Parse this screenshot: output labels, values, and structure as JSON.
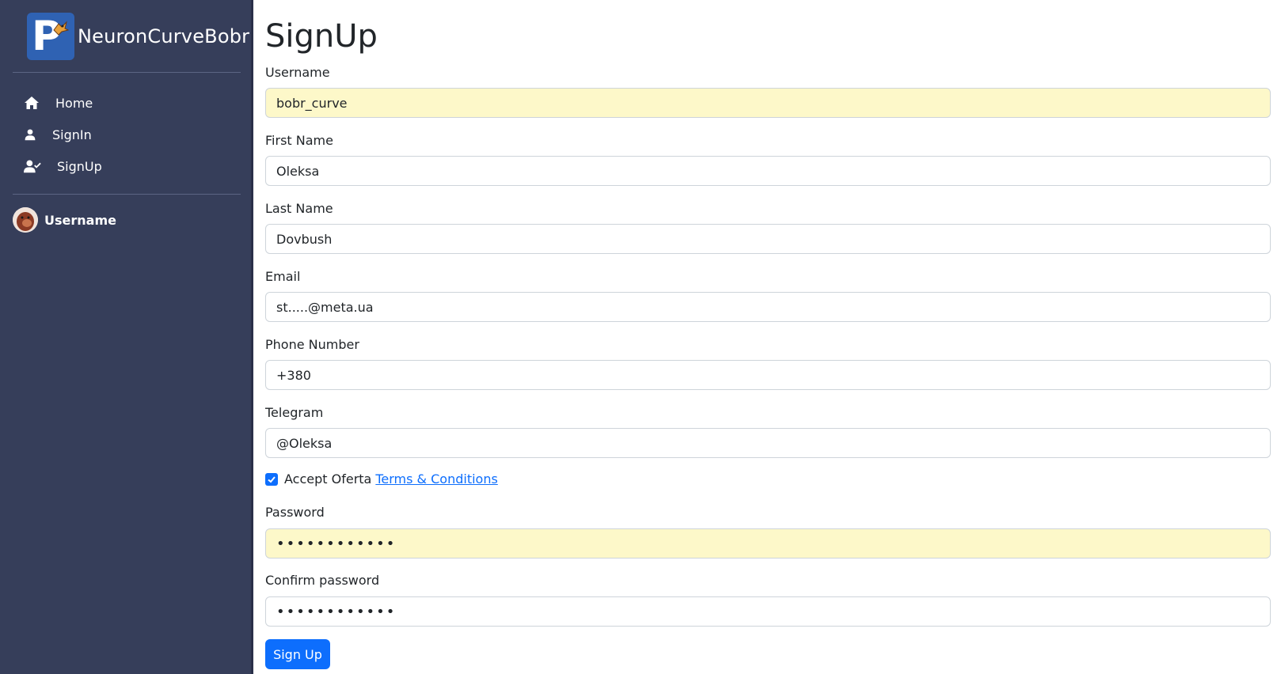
{
  "brand": {
    "name": "NeuronCurveBobr",
    "logo_letter": "P"
  },
  "sidebar": {
    "items": [
      {
        "label": "Home",
        "icon": "home-icon"
      },
      {
        "label": "SignIn",
        "icon": "user-icon"
      },
      {
        "label": "SignUp",
        "icon": "user-check-icon"
      }
    ],
    "user": {
      "name": "Username"
    }
  },
  "main": {
    "title": "SignUp"
  },
  "form": {
    "username": {
      "label": "Username",
      "value": "bobr_curve"
    },
    "first_name": {
      "label": "First Name",
      "value": "Oleksa"
    },
    "last_name": {
      "label": "Last Name",
      "value": "Dovbush"
    },
    "email": {
      "label": "Email",
      "value": "st.....@meta.ua"
    },
    "phone": {
      "label": "Phone Number",
      "value": "+380"
    },
    "telegram": {
      "label": "Telegram",
      "value": "@Oleksa"
    },
    "accept": {
      "text": "Accept Oferta",
      "link": "Terms & Conditions",
      "checked": true
    },
    "password": {
      "label": "Password",
      "value": "••••••••••••"
    },
    "confirm_password": {
      "label": "Confirm password",
      "value": "••••••••••••"
    },
    "submit_label": "Sign Up"
  },
  "colors": {
    "sidebar_bg": "#363e5a",
    "primary": "#0d6efd",
    "autofill": "#fdf8c9"
  }
}
